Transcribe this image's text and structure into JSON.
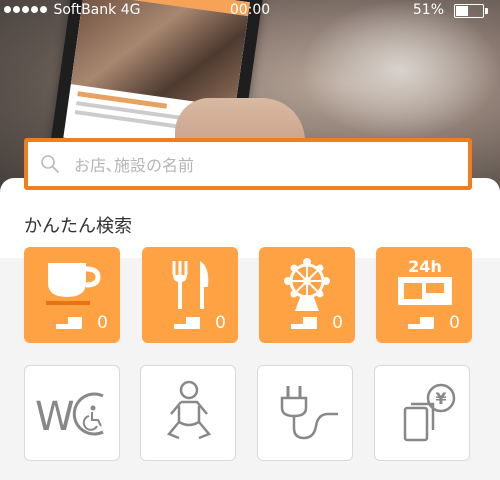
{
  "status_bar": {
    "carrier": "SoftBank",
    "network": "4G",
    "time": "00:00",
    "battery": "51%",
    "battery_level": 0.51
  },
  "search": {
    "placeholder": "お店､施設の名前",
    "value": ""
  },
  "quick_search": {
    "title": "かんたん検索",
    "categories": [
      {
        "icon": "cafe-cup-icon",
        "count": "0"
      },
      {
        "icon": "restaurant-fork-knife-icon",
        "count": "0"
      },
      {
        "icon": "amusement-ferris-wheel-icon",
        "count": "0"
      },
      {
        "icon": "convenience-store-24h-icon",
        "count": "0",
        "label": "24h"
      }
    ],
    "facilities": [
      {
        "icon": "accessible-restroom-icon",
        "label": "WC"
      },
      {
        "icon": "baby-changing-icon"
      },
      {
        "icon": "power-outlet-icon"
      },
      {
        "icon": "yen-payment-icon",
        "label": "¥"
      }
    ]
  },
  "colors": {
    "accent": "#ffa243",
    "search_border": "#f07e1e"
  }
}
